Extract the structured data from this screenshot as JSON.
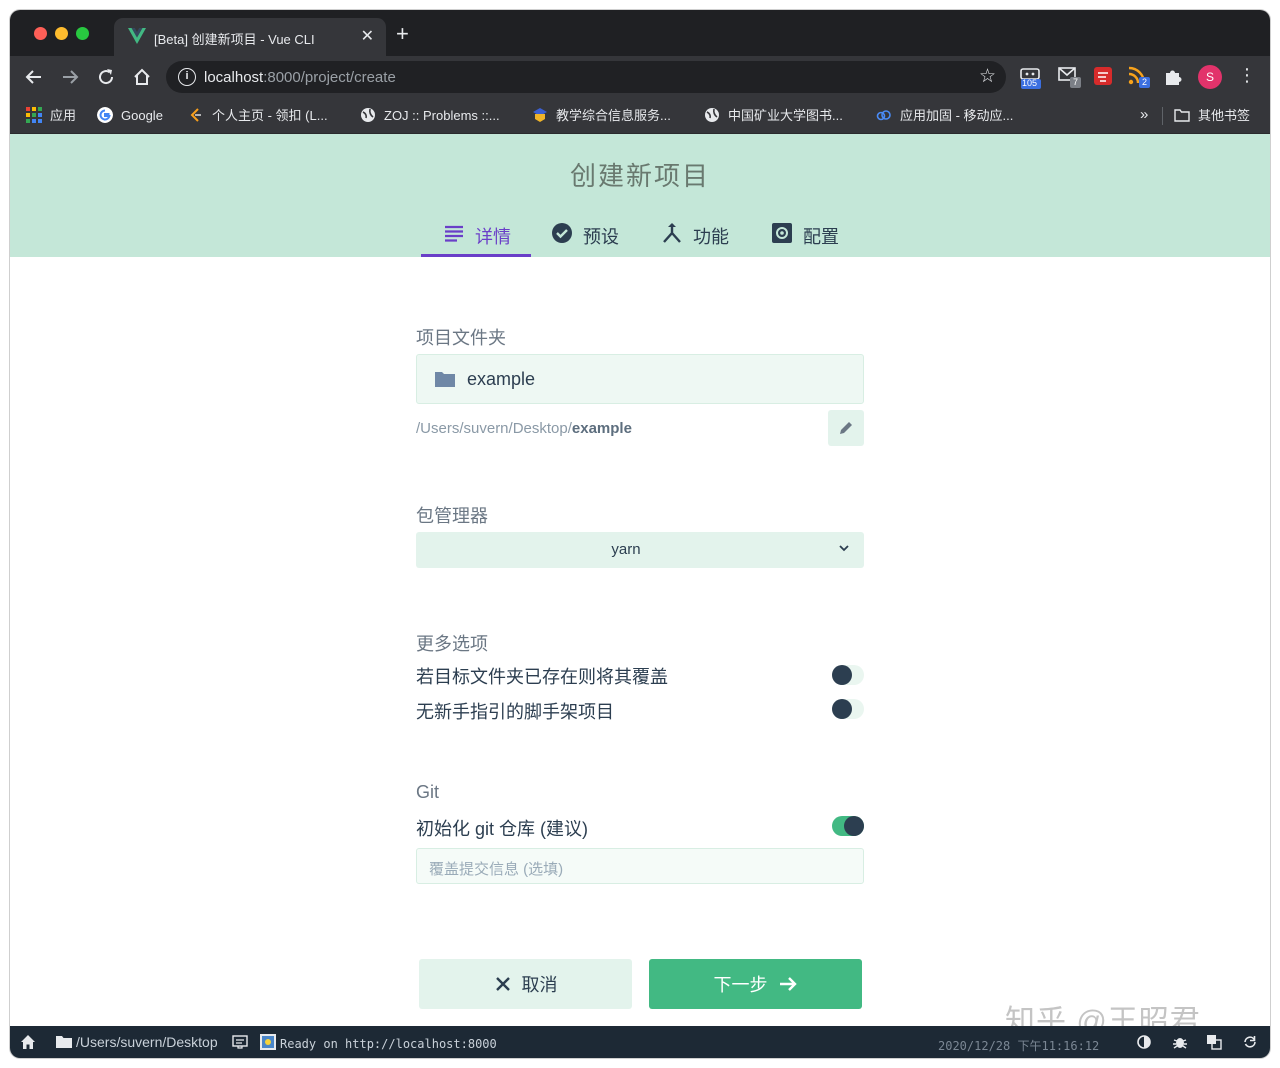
{
  "browser": {
    "tab": {
      "title": "[Beta] 创建新项目 - Vue CLI",
      "close": "✕"
    },
    "new_tab": "+",
    "url_host": "localhost",
    "url_path": ":8000/project/create",
    "extensions": [
      {
        "badge": "105"
      },
      {
        "badge": "7"
      },
      {
        "badge": ""
      },
      {
        "badge": "2"
      },
      {
        "badge": ""
      }
    ],
    "avatar_letter": "S",
    "bookmarks": [
      {
        "label": "应用"
      },
      {
        "label": "Google"
      },
      {
        "label": "个人主页 - 领扣 (L..."
      },
      {
        "label": "ZOJ :: Problems ::..."
      },
      {
        "label": "教学综合信息服务..."
      },
      {
        "label": "中国矿业大学图书..."
      },
      {
        "label": "应用加固 - 移动应..."
      }
    ],
    "bookmarks_more": "»",
    "other_bookmarks": "其他书签"
  },
  "header": {
    "title": "创建新项目",
    "steps": [
      {
        "label": "详情",
        "icon": "list-icon",
        "active": true
      },
      {
        "label": "预设",
        "icon": "check-circle-icon"
      },
      {
        "label": "功能",
        "icon": "merge-icon"
      },
      {
        "label": "配置",
        "icon": "settings-box-icon"
      }
    ]
  },
  "form": {
    "folder": {
      "label": "项目文件夹",
      "value": "example",
      "path_prefix": "/Users/suvern/Desktop/",
      "path_name": "example"
    },
    "package_manager": {
      "label": "包管理器",
      "value": "yarn"
    },
    "more": {
      "label": "更多选项",
      "options": [
        {
          "label": "若目标文件夹已存在则将其覆盖",
          "enabled": false
        },
        {
          "label": "无新手指引的脚手架项目",
          "enabled": false
        }
      ]
    },
    "git": {
      "label": "Git",
      "init_label": "初始化 git 仓库 (建议)",
      "init_enabled": true,
      "commit_placeholder": "覆盖提交信息 (选填)"
    }
  },
  "actions": {
    "cancel": "取消",
    "next": "下一步"
  },
  "watermark": "知乎 @王昭君",
  "statusbar": {
    "cwd": "/Users/suvern/Desktop",
    "log": "Ready on http://localhost:8000",
    "datetime": "2020/12/28 下午11:16:12"
  },
  "colors": {
    "accent": "#42b983",
    "header_bg": "#c4e7d8",
    "active_step": "#6a3fc8",
    "statusbar_bg": "#1d2935"
  }
}
